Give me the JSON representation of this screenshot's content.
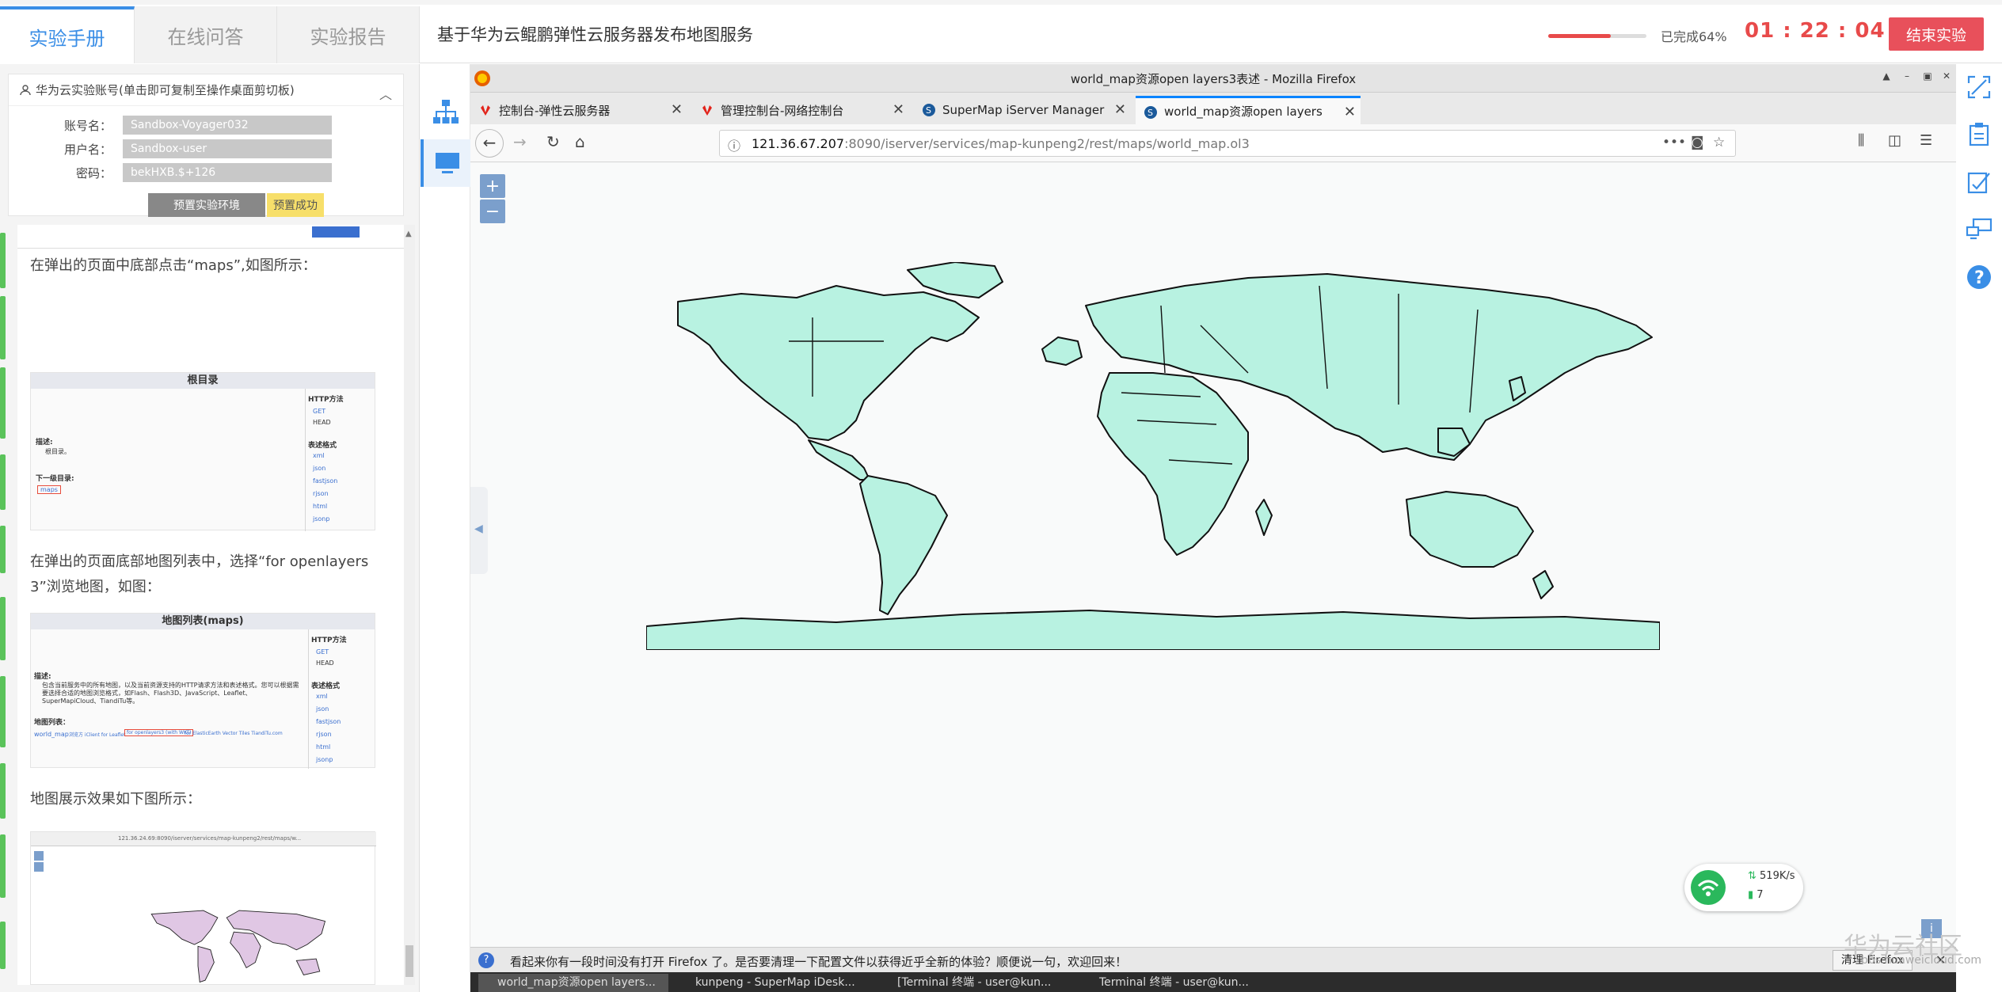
{
  "header": {
    "tabs": [
      {
        "label": "实验手册"
      },
      {
        "label": "在线问答"
      },
      {
        "label": "实验报告"
      }
    ],
    "lab_title": "基于华为云鲲鹏弹性云服务器发布地图服务",
    "progress_percent": 64,
    "progress_label": "已完成64%",
    "timer": "01 : 22 : 04",
    "end_button": "结束实验",
    "accent_color": "#3a8ee6",
    "danger_color": "#e84a4a"
  },
  "account": {
    "heading": "华为云实验账号(单击即可复制至操作桌面剪切板)",
    "rows": [
      {
        "label": "账号名：",
        "value": "Sandbox-Voyager032"
      },
      {
        "label": "用户名：",
        "value": "Sandbox-user"
      },
      {
        "label": "密码：",
        "value": "bekHXB.$+126"
      }
    ],
    "prep_button": "预置实验环境",
    "prep_status": "预置成功"
  },
  "manual": {
    "para1": "在弹出的页面中底部点击“maps”,如图所示：",
    "shot1": {
      "title": "根目录",
      "http_methods": "HTTP方法",
      "get": "GET",
      "head": "HEAD",
      "desc_label": "描述:",
      "desc_text": "根目录。",
      "next_label": "下一级目录:",
      "next_link": "maps",
      "formats_label": "表述格式",
      "formats": [
        "xml",
        "json",
        "fastjson",
        "rjson",
        "html",
        "jsonp"
      ]
    },
    "para2a": "在弹出的页面底部地图列表中，选择“for openlayers",
    "para2b": "3”浏览地图，如图：",
    "shot2": {
      "title": "地图列表(maps)",
      "http_methods": "HTTP方法",
      "get": "GET",
      "head": "HEAD",
      "desc_label": "描述:",
      "desc_text": "包含当前服务中的所有地图，以及当前资源支持的HTTP请求方法和表述格式。您可以根据需要选择合适的地图浏览格式，如Flash、Flash3D、JavaScript、Leaflet、SuperMapiCloud、TiandiTu等。",
      "list_label": "地图列表：",
      "map_name": "world_map",
      "map_links": "浏览方 iClient for Leaflet",
      "map_link_sel": "for openlayers3 (with WKT)",
      "map_link_rest": "for ElasticEarth  Vector Tiles  TiandiTu.com",
      "formats_label": "表述格式",
      "formats": [
        "xml",
        "json",
        "fastjson",
        "rjson",
        "html",
        "jsonp"
      ]
    },
    "para3": "地图展示效果如下图所示：",
    "shot3": {
      "url": "121.36.24.69:8090/iserver/services/map-kunpeng2/rest/maps/w..."
    }
  },
  "remote": {
    "window_title": "world_map资源open layers3表述 - Mozilla Firefox",
    "tabs": [
      {
        "label": "控制台-弹性云服务器"
      },
      {
        "label": "管理控制台-网络控制台"
      },
      {
        "label": "SuperMap iServer Manager"
      },
      {
        "label": "world_map资源open layers3"
      }
    ],
    "url_host": "121.36.67.207",
    "url_rest": ":8090/iserver/services/map-kunpeng2/rest/maps/world_map.ol3",
    "zoom_in": "+",
    "zoom_out": "−",
    "network_speed": "519K/s",
    "network_count": "7",
    "notification": "看起来你有一段时间没有打开 Firefox 了。是否要清理一下配置文件以获得近乎全新的体验？顺便说一句，欢迎回来！",
    "notif_button": "清理 Firefox",
    "taskbar": [
      {
        "label": "world_map资源open layers..."
      },
      {
        "label": "kunpeng - SuperMap iDesk..."
      },
      {
        "label": "[Terminal 终端 - user@kun..."
      },
      {
        "label": "Terminal 终端 - user@kun..."
      }
    ],
    "map_land_color": "#b8f2e1"
  },
  "watermark": {
    "main": "华为云社区",
    "sub": "bbs.huaweicloud.com"
  }
}
